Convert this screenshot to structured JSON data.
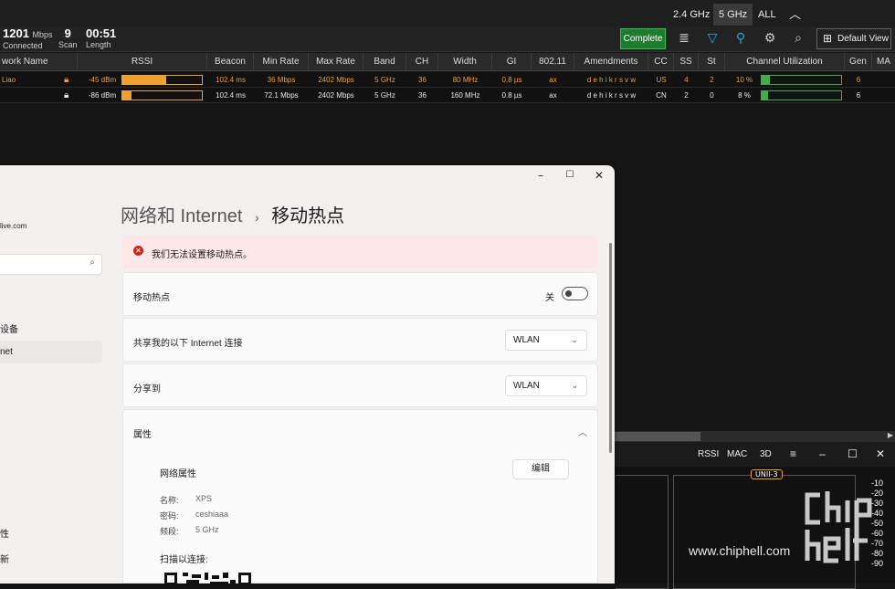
{
  "top_tabs": [
    {
      "label": "2.4 GHz",
      "active": false
    },
    {
      "label": "5 GHz",
      "active": true
    },
    {
      "label": "ALL",
      "active": false
    }
  ],
  "status": {
    "rate_value": "1201",
    "rate_unit": "Mbps",
    "rate_label": "Connected",
    "scan_value": "9",
    "scan_label": "Scan",
    "length_value": "00:51",
    "length_label": "Length",
    "complete_label": "Complete",
    "default_view_label": "Default View"
  },
  "columns": [
    "work Name",
    "RSSI",
    "Beacon",
    "Min Rate",
    "Max Rate",
    "Band",
    "CH",
    "Width",
    "GI",
    "802.11",
    "Amendments",
    "CC",
    "SS",
    "St",
    "Channel Utilization",
    "Gen",
    "MA"
  ],
  "rows": [
    {
      "name": "Liao",
      "rssi": "-45 dBm",
      "rssi_level": 0.55,
      "beacon": "102.4 ms",
      "min_rate": "36 Mbps",
      "max_rate": "2402 Mbps",
      "band": "5 GHz",
      "ch": "36",
      "width": "80 MHz",
      "gi": "0.8 µs",
      "std": "ax",
      "amend": "d e h i k r s v w",
      "cc": "US",
      "ss": "4",
      "st": "2",
      "util": "10 %",
      "util_level": 0.1,
      "gen": "6"
    },
    {
      "name": "",
      "rssi": "-86 dBm",
      "rssi_level": 0.12,
      "beacon": "102.4 ms",
      "min_rate": "72.1 Mbps",
      "max_rate": "2402 Mbps",
      "band": "5 GHz",
      "ch": "36",
      "width": "160 MHz",
      "gi": "0.8 µs",
      "std": "ax",
      "amend": "d e h i k r s v w",
      "cc": "CN",
      "ss": "2",
      "st": "0",
      "util": "8 %",
      "util_level": 0.08,
      "gen": "6"
    }
  ],
  "bottom_panel": {
    "buttons": [
      "RSSI",
      "MAC",
      "3D"
    ],
    "unii_label": "UNII-3",
    "ticks": [
      "-10",
      "-20",
      "-30",
      "-40",
      "-50",
      "-60",
      "-70",
      "-80",
      "-90"
    ]
  },
  "settings": {
    "side": {
      "email": "live.com",
      "item_devices": "设备",
      "item_internet": "net",
      "item_bottom1": "性",
      "item_bottom2": "新"
    },
    "breadcrumb_parent": "网络和 Internet",
    "breadcrumb_sep": "›",
    "breadcrumb_current": "移动热点",
    "error_text": "我们无法设置移动热点。",
    "hotspot_label": "移动热点",
    "hotspot_state": "关",
    "share_from_label": "共享我的以下 Internet 连接",
    "share_from_value": "WLAN",
    "share_to_label": "分享到",
    "share_to_value": "WLAN",
    "props_label": "属性",
    "net_props_label": "网络属性",
    "edit_label": "编辑",
    "name_label": "名称:",
    "name_value": "XPS",
    "pwd_label": "密码:",
    "pwd_value": "ceshiaaa",
    "band_label": "频段:",
    "band_value": "5 GHz",
    "scan_label": "扫描以连接:"
  },
  "watermark": "www.chiphell.com"
}
